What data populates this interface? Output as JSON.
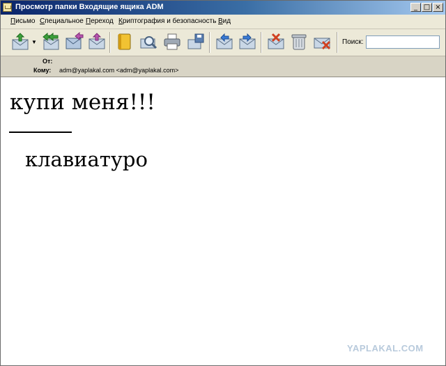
{
  "window": {
    "title": "Просмотр папки Входящие ящика ADM",
    "controls": [
      "minimize-icon",
      "maximize-icon",
      "close-icon"
    ]
  },
  "menu": [
    {
      "first": "П",
      "rest": "исьмо"
    },
    {
      "first": "С",
      "rest": "пециальное"
    },
    {
      "first": "П",
      "rest": "ереход"
    },
    {
      "first": "К",
      "rest": "риптография и безопасность"
    },
    {
      "first": "В",
      "rest": "ид"
    }
  ],
  "toolbar": {
    "icons": [
      "get-mail-icon",
      "dropdown-arrow-icon",
      "reply-all-icon",
      "forward-icon",
      "new-message-icon",
      "address-book-icon",
      "search-messages-icon",
      "print-icon",
      "save-icon",
      "previous-message-icon",
      "next-message-icon",
      "junk-icon",
      "trash-icon",
      "delete-icon"
    ],
    "search_label": "Поиск:",
    "search_value": ""
  },
  "headers": {
    "from_label": "От:",
    "from_value": "",
    "to_label": "Кому:",
    "to_value": "adm@yaplakal.com <adm@yaplakal.com>"
  },
  "message": {
    "subject_line": "купи меня!!!",
    "signature_line": "клавиатуро"
  },
  "watermark": "YAPLAKAL.COM",
  "colors": {
    "titlebar_start": "#0a246a",
    "titlebar_end": "#a6caf0",
    "chrome": "#ece9d8",
    "watermark": "#b8cadc"
  }
}
